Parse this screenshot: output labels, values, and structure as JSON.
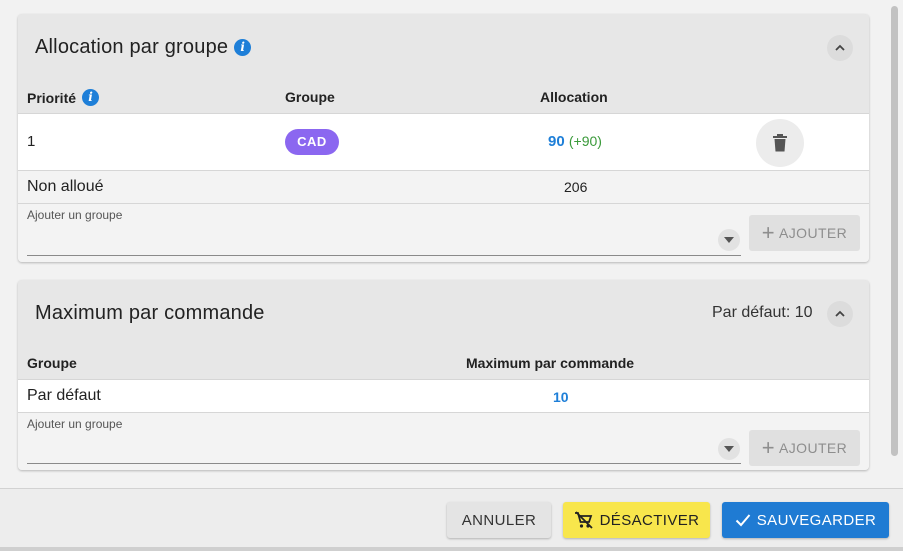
{
  "allocation_card": {
    "title": "Allocation par groupe",
    "columns": {
      "priority": "Priorité",
      "group": "Groupe",
      "allocation": "Allocation"
    },
    "rows": [
      {
        "priority": "1",
        "group": "CAD",
        "allocation": "90",
        "delta": "(+90)"
      }
    ],
    "unallocated": {
      "label": "Non alloué",
      "value": "206"
    },
    "add_group": {
      "label": "Ajouter un groupe",
      "button": "AJOUTER"
    }
  },
  "max_card": {
    "title": "Maximum par commande",
    "default_summary": "Par défaut: 10",
    "columns": {
      "group": "Groupe",
      "max": "Maximum par commande"
    },
    "rows": [
      {
        "group": "Par défaut",
        "max": "10"
      }
    ],
    "add_group": {
      "label": "Ajouter un groupe",
      "button": "AJOUTER"
    }
  },
  "footer": {
    "cancel": "ANNULER",
    "disable": "DÉSACTIVER",
    "save": "SAUVEGARDER"
  },
  "colors": {
    "accent_blue": "#1e7fd8",
    "badge_purple": "#8b67f0",
    "positive_green": "#3a9a3a",
    "warning_yellow": "#f8e64c"
  }
}
